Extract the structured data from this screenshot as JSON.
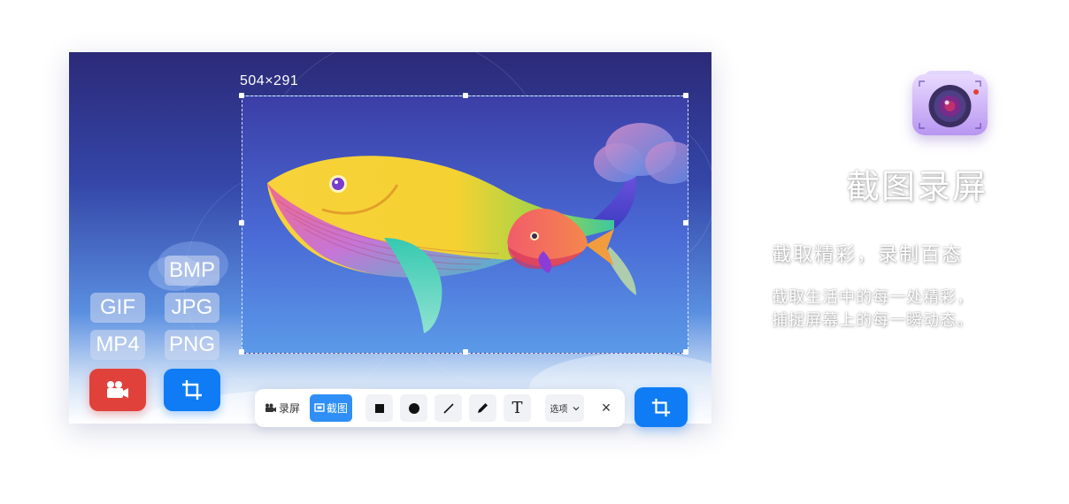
{
  "selection": {
    "dimensions": "504×291"
  },
  "formats": {
    "bmp": "BMP",
    "gif": "GIF",
    "jpg": "JPG",
    "mp4": "MP4",
    "png": "PNG"
  },
  "toolbar": {
    "record_label": "录屏",
    "screenshot_label": "截图",
    "text_tool_glyph": "T",
    "options_label": "选项",
    "close_glyph": "×"
  },
  "promo": {
    "title": "截图录屏",
    "subtitle": "截取精彩，录制百态",
    "line1": "截取生活中的每一处精彩，",
    "line2": "捕捉屏幕上的每一瞬动态。"
  },
  "icons": {
    "record": "video-camera-icon",
    "crop": "crop-icon",
    "rectangle": "square-icon",
    "ellipse": "circle-icon",
    "line": "line-icon",
    "pen": "pen-icon",
    "app": "camera-app-icon"
  },
  "colors": {
    "accent_blue": "#0f7cf5",
    "record_red": "#e0413b",
    "active_tab": "#2f8ff7"
  }
}
